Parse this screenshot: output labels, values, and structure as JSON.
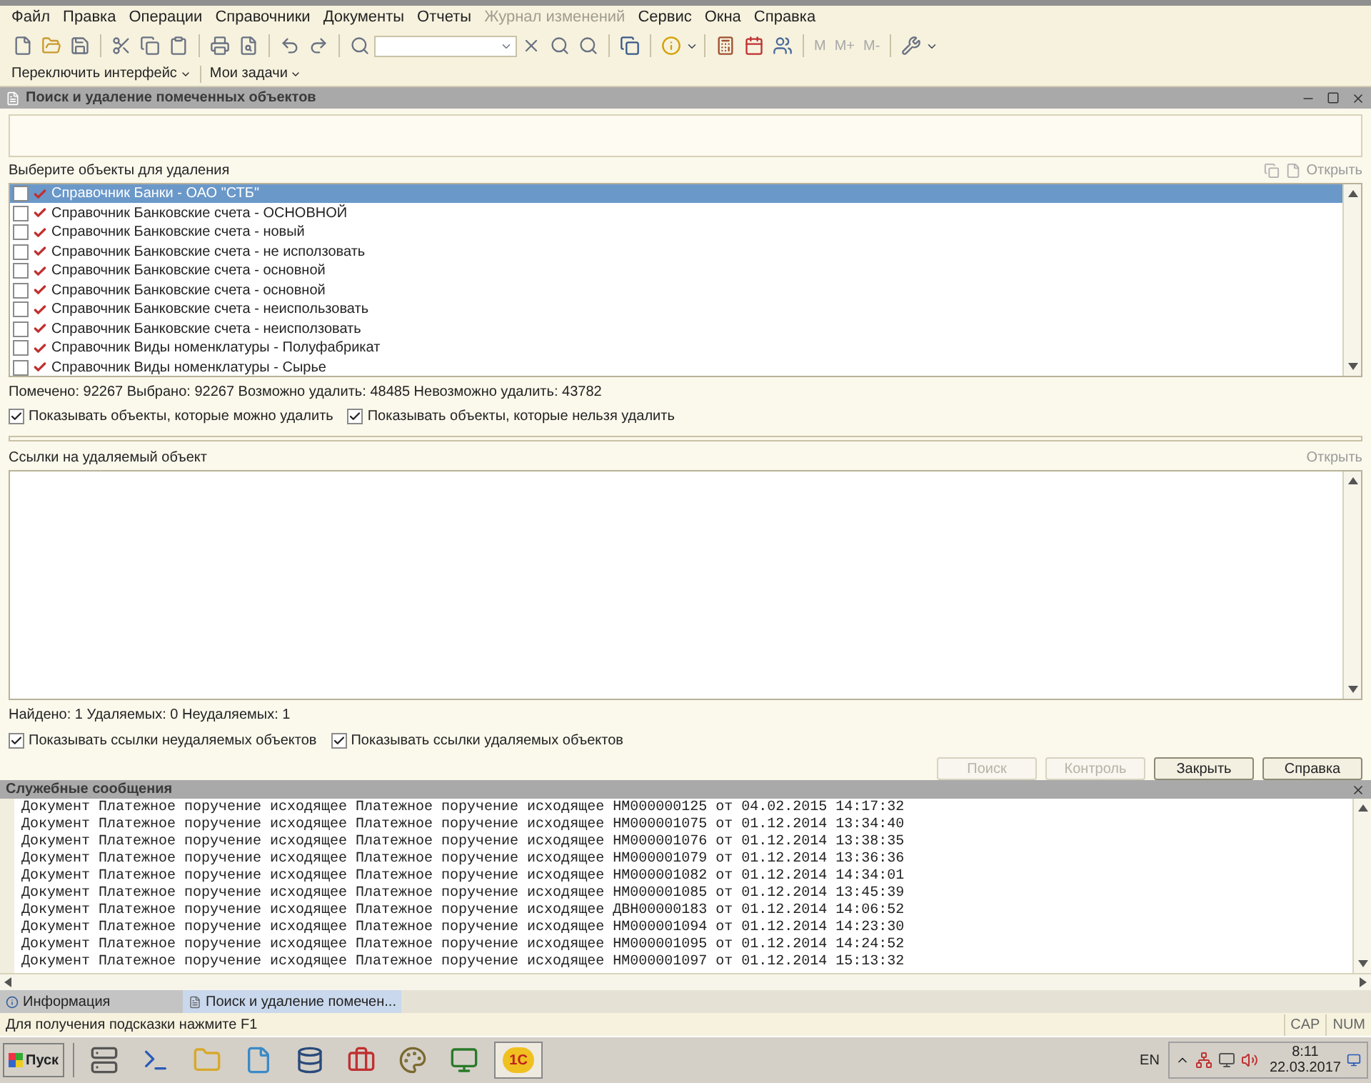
{
  "menu": [
    {
      "label": "Файл",
      "disabled": false
    },
    {
      "label": "Правка",
      "disabled": false
    },
    {
      "label": "Операции",
      "disabled": false
    },
    {
      "label": "Справочники",
      "disabled": false
    },
    {
      "label": "Документы",
      "disabled": false
    },
    {
      "label": "Отчеты",
      "disabled": false
    },
    {
      "label": "Журнал изменений",
      "disabled": true
    },
    {
      "label": "Сервис",
      "disabled": false
    },
    {
      "label": "Окна",
      "disabled": false
    },
    {
      "label": "Справка",
      "disabled": false
    }
  ],
  "memory_buttons": [
    {
      "label": "M",
      "disabled": true
    },
    {
      "label": "M+",
      "disabled": true
    },
    {
      "label": "M-",
      "disabled": true
    }
  ],
  "panel_buttons": [
    {
      "label": "Переключить интерфейс"
    },
    {
      "label": "Мои задачи"
    }
  ],
  "document": {
    "title": "Поиск и удаление помеченных объектов",
    "select_label": "Выберите объекты для удаления",
    "open_link": {
      "label": "Открыть",
      "disabled": true
    },
    "objects": [
      {
        "label": "Справочник Банки - ОАО \"СТБ\"",
        "checked": false,
        "selected": true
      },
      {
        "label": "Справочник Банковские счета - ОСНОВНОЙ",
        "checked": false,
        "selected": false
      },
      {
        "label": "Справочник Банковские счета - новый",
        "checked": false,
        "selected": false
      },
      {
        "label": "Справочник Банковские счета - не иcползовать",
        "checked": false,
        "selected": false
      },
      {
        "label": "Справочник Банковские счета - основной",
        "checked": false,
        "selected": false
      },
      {
        "label": "Справочник Банковские счета - основной",
        "checked": false,
        "selected": false
      },
      {
        "label": "Справочник Банковские счета - неиспользовать",
        "checked": false,
        "selected": false
      },
      {
        "label": "Справочник Банковские счета - неисползовать",
        "checked": false,
        "selected": false
      },
      {
        "label": "Справочник Виды номенклатуры - Полуфабрикат",
        "checked": false,
        "selected": false
      },
      {
        "label": "Справочник Виды номенклатуры - Сырье",
        "checked": false,
        "selected": false
      }
    ],
    "summary": "Помечено: 92267  Выбрано: 92267  Возможно удалить: 48485  Невозможно удалить: 43782",
    "object_options": [
      {
        "label": "Показывать объекты, которые можно удалить",
        "checked": true
      },
      {
        "label": "Показывать объекты, которые нельзя удалить",
        "checked": true
      }
    ],
    "references_label": "Ссылки на удаляемый объект",
    "references_open": {
      "label": "Открыть",
      "disabled": true
    },
    "found_summary": "Найдено: 1  Удаляемых: 0  Неудаляемых: 1",
    "reference_options": [
      {
        "label": "Показывать ссылки неудаляемых объектов",
        "checked": true
      },
      {
        "label": "Показывать ссылки удаляемых объектов",
        "checked": true
      }
    ],
    "buttons": [
      {
        "label": "Поиск",
        "disabled": true
      },
      {
        "label": "Контроль",
        "disabled": true
      },
      {
        "label": "Закрыть",
        "disabled": false
      },
      {
        "label": "Справка",
        "disabled": false
      }
    ]
  },
  "messages": {
    "title": "Служебные сообщения",
    "lines": [
      "Документ Платежное поручение исходящее Платежное поручение исходящее НМ000000125 от 04.02.2015 14:17:32",
      "Документ Платежное поручение исходящее Платежное поручение исходящее НМ000001075 от 01.12.2014 13:34:40",
      "Документ Платежное поручение исходящее Платежное поручение исходящее НМ000001076 от 01.12.2014 13:38:35",
      "Документ Платежное поручение исходящее Платежное поручение исходящее НМ000001079 от 01.12.2014 13:36:36",
      "Документ Платежное поручение исходящее Платежное поручение исходящее НМ000001082 от 01.12.2014 14:34:01",
      "Документ Платежное поручение исходящее Платежное поручение исходящее НМ000001085 от 01.12.2014 13:45:39",
      "Документ Платежное поручение исходящее Платежное поручение исходящее ДВН00000183 от 01.12.2014 14:06:52",
      "Документ Платежное поручение исходящее Платежное поручение исходящее НМ000001094 от 01.12.2014 14:23:30",
      "Документ Платежное поручение исходящее Платежное поручение исходящее НМ000001095 от 01.12.2014 14:24:52",
      "Документ Платежное поручение исходящее Платежное поручение исходящее НМ000001097 от 01.12.2014 15:13:32"
    ]
  },
  "window_tabs": [
    {
      "label": "Информация",
      "selected": false
    },
    {
      "label": "Поиск и удаление помечен...",
      "selected": true
    }
  ],
  "status_bar": {
    "hint": "Для получения подсказки нажмите F1",
    "indicators": [
      "CAP",
      "NUM"
    ]
  },
  "taskbar": {
    "start": "Пуск",
    "active_app": "1С",
    "language": "EN",
    "time": "8:11",
    "date": "22.03.2017"
  }
}
